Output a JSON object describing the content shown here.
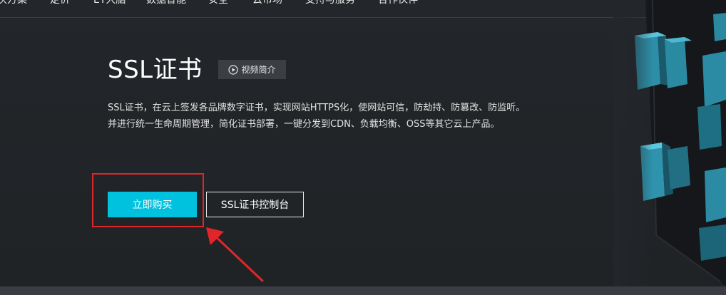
{
  "nav": {
    "items": [
      "决方案",
      "定价",
      "ET大脑",
      "数据智能",
      "安全",
      "云市场",
      "支持与服务",
      "合作伙伴"
    ]
  },
  "hero": {
    "title": "SSL证书",
    "video_label": "视频简介",
    "description_line1": "SSL证书，在云上签发各品牌数字证书，实现网站HTTPS化，使网站可信，防劫持、防篡改、防监听。",
    "description_line2": "并进行统一生命周期管理，简化证书部署，一键分发到CDN、负载均衡、OSS等其它云上产品。",
    "buy_label": "立即购买",
    "console_label": "SSL证书控制台"
  },
  "colors": {
    "accent": "#00c1de",
    "background": "#222427",
    "annotation": "#e0262a"
  },
  "icons": {
    "video": "play-circle-icon"
  }
}
